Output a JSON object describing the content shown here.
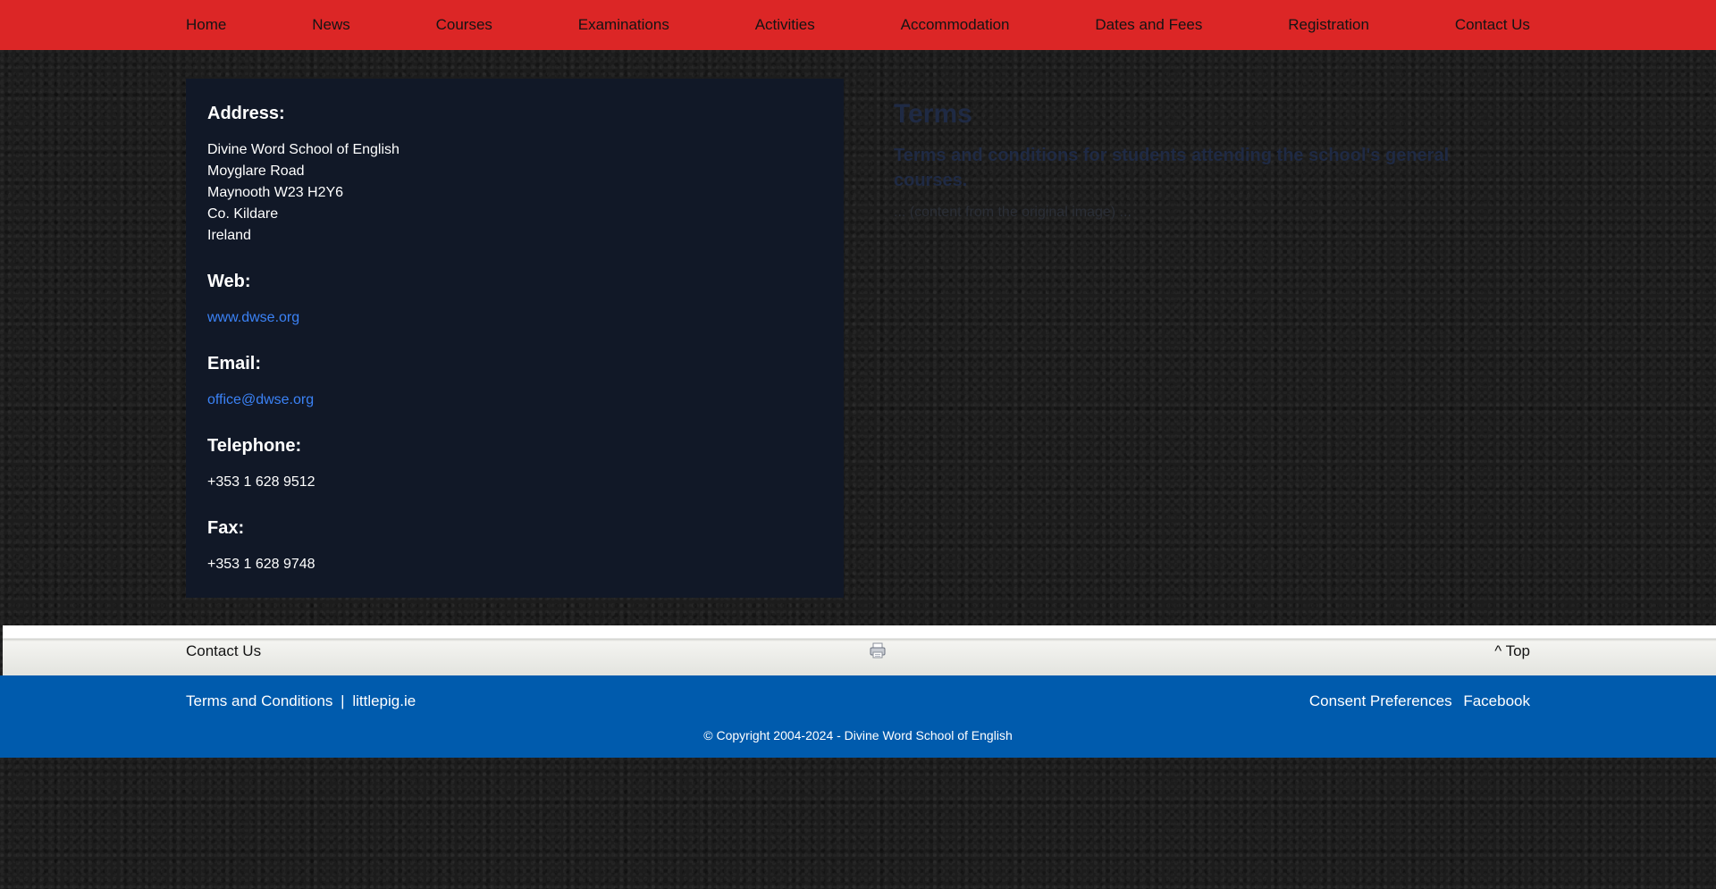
{
  "nav": {
    "items": [
      "Home",
      "News",
      "Courses",
      "Examinations",
      "Activities",
      "Accommodation",
      "Dates and Fees",
      "Registration",
      "Contact Us"
    ]
  },
  "contact": {
    "address_heading": "Address:",
    "address_lines": [
      "Divine Word School of English",
      "Moyglare Road",
      "Maynooth W23 H2Y6",
      "Co. Kildare",
      "Ireland"
    ],
    "web_heading": "Web:",
    "web_link": "www.dwse.org",
    "email_heading": "Email:",
    "email_link": "office@dwse.org",
    "telephone_heading": "Telephone:",
    "telephone_value": "+353 1 628 9512",
    "fax_heading": "Fax:",
    "fax_value": "+353 1 628 9748"
  },
  "terms": {
    "title": "Terms",
    "subtitle": "Terms and conditions for students attending the school's general courses.",
    "body": "... (content from the original image) ..."
  },
  "footer_bar": {
    "left_link": "Contact Us",
    "print_icon": "printer-icon",
    "top_link": "^ Top"
  },
  "blue_footer": {
    "terms_link": "Terms and Conditions",
    "separator": "|",
    "littlepig_link": "littlepig.ie",
    "consent_link": "Consent Preferences",
    "facebook_link": "Facebook",
    "copyright": "© Copyright 2004-2024 - Divine Word School of English"
  },
  "colors": {
    "nav_bg": "#dc2626",
    "card_bg": "#111827",
    "link": "#3b82f6",
    "footer_blue": "#005bad"
  }
}
